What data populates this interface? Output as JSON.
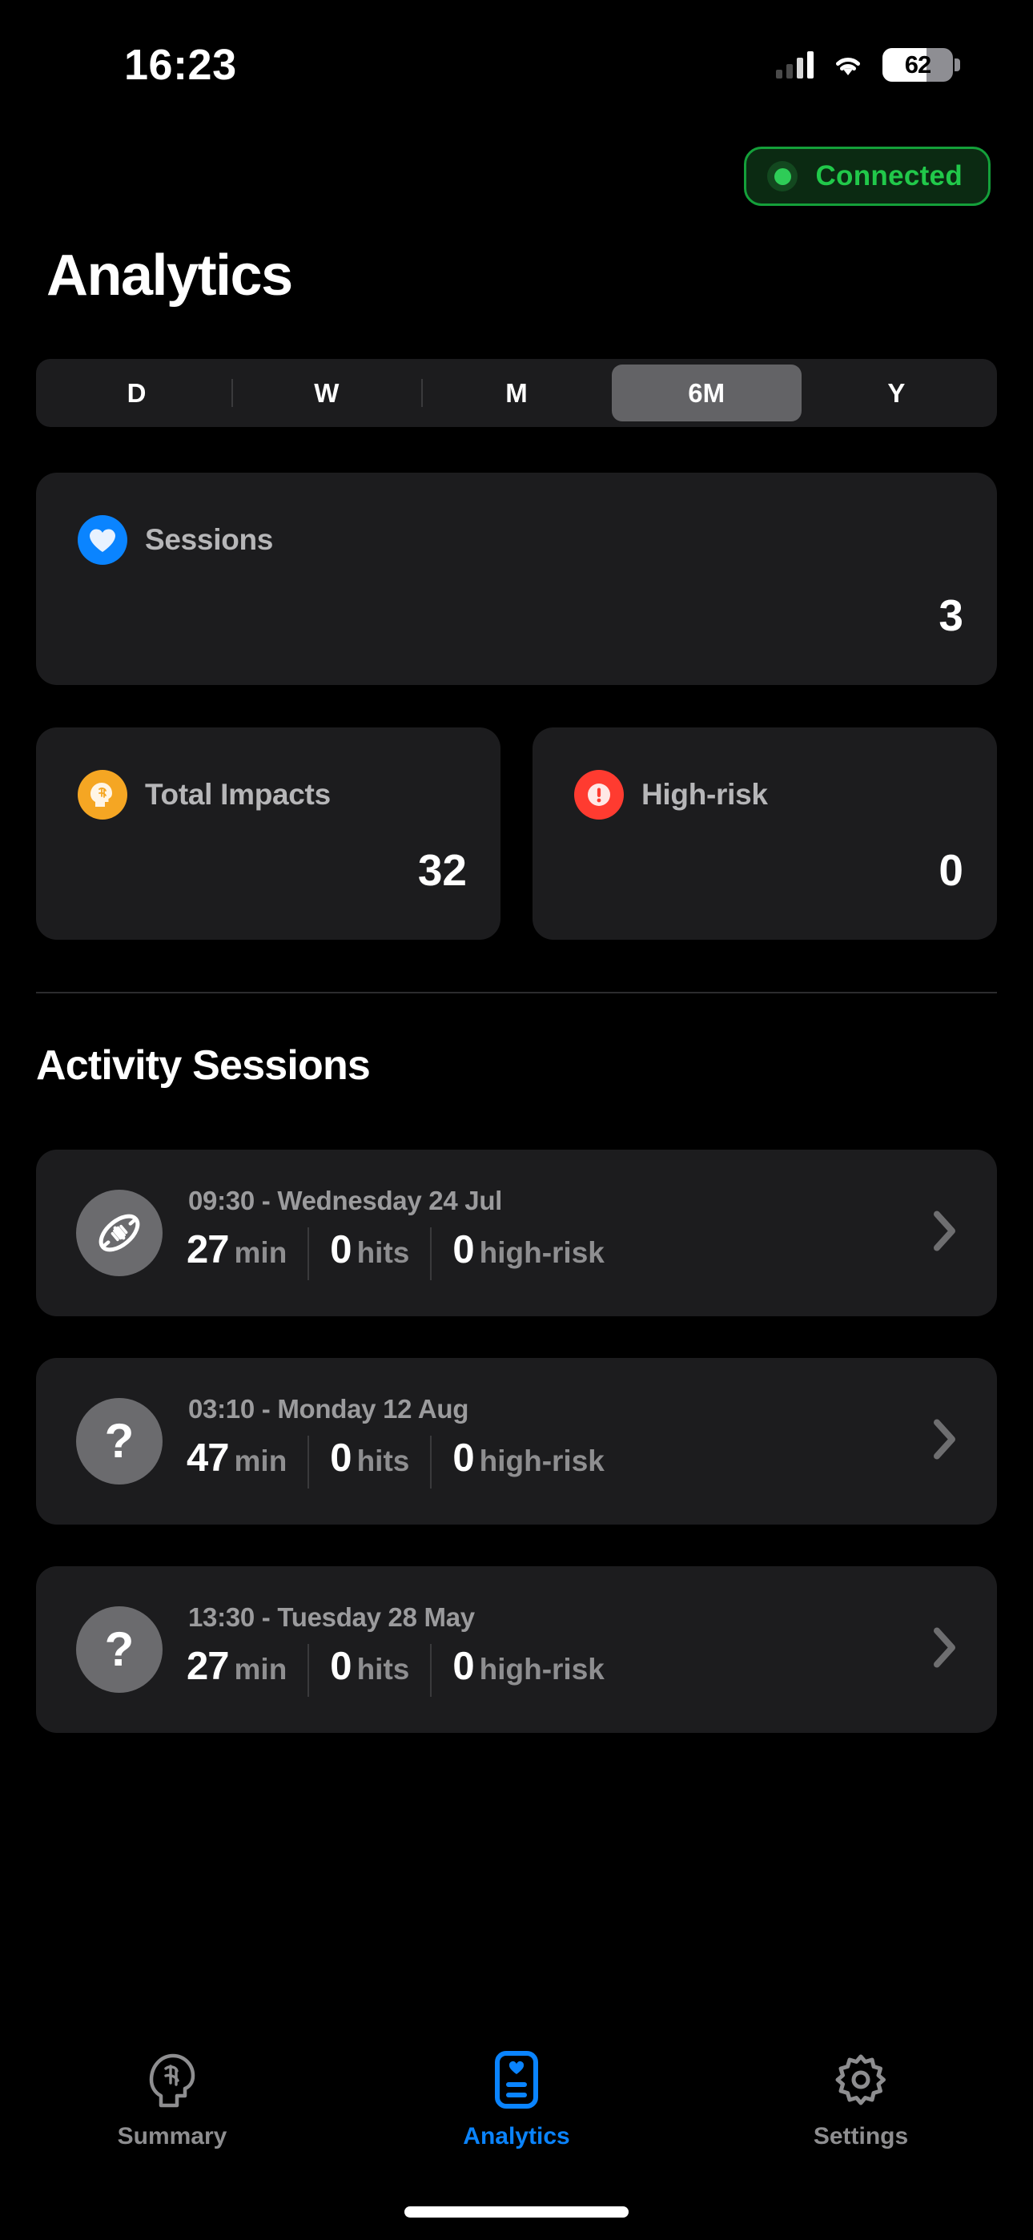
{
  "status_bar": {
    "time": "16:23",
    "battery_percent": "62",
    "icons": [
      "cellular-signal-icon",
      "wifi-icon",
      "battery-icon"
    ]
  },
  "connection": {
    "status_label": "Connected",
    "dot_color": "#2ecc57",
    "border_color": "#14a03a",
    "text_color": "#21c84a"
  },
  "header": {
    "title": "Analytics"
  },
  "range_selector": {
    "options": [
      {
        "label": "D",
        "selected": false
      },
      {
        "label": "W",
        "selected": false
      },
      {
        "label": "M",
        "selected": false
      },
      {
        "label": "6M",
        "selected": true
      },
      {
        "label": "Y",
        "selected": false
      }
    ],
    "selected": "6M"
  },
  "summary_cards": {
    "sessions": {
      "label": "Sessions",
      "value": "3",
      "icon": "heart-icon",
      "icon_bg": "#0a84ff"
    },
    "total_impacts": {
      "label": "Total Impacts",
      "value": "32",
      "icon": "brain-head-icon",
      "icon_bg": "#f5a623"
    },
    "high_risk": {
      "label": "High-risk",
      "value": "0",
      "icon": "exclamation-icon",
      "icon_bg": "#ff3b30"
    }
  },
  "activity": {
    "section_title": "Activity Sessions",
    "stat_units": {
      "duration": "min",
      "hits": "hits",
      "high_risk": "high-risk"
    },
    "sessions": [
      {
        "icon": "football-icon",
        "icon_glyph": "",
        "datetime": "09:30 - Wednesday 24 Jul",
        "duration": "27",
        "duration_unit": "min",
        "hits": "0",
        "hits_unit": "hits",
        "high_risk": "0",
        "high_risk_unit": "high-risk"
      },
      {
        "icon": "question-mark-icon",
        "icon_glyph": "?",
        "datetime": "03:10 - Monday 12 Aug",
        "duration": "47",
        "duration_unit": "min",
        "hits": "0",
        "hits_unit": "hits",
        "high_risk": "0",
        "high_risk_unit": "high-risk"
      },
      {
        "icon": "question-mark-icon",
        "icon_glyph": "?",
        "datetime": "13:30 - Tuesday 28 May",
        "duration": "27",
        "duration_unit": "min",
        "hits": "0",
        "hits_unit": "hits",
        "high_risk": "0",
        "high_risk_unit": "high-risk"
      }
    ]
  },
  "tab_bar": {
    "active_color": "#0a84ff",
    "inactive_color": "#8e8e90",
    "tabs": [
      {
        "label": "Summary",
        "icon": "brain-head-icon",
        "active": false
      },
      {
        "label": "Analytics",
        "icon": "analytics-card-icon",
        "active": true
      },
      {
        "label": "Settings",
        "icon": "gear-icon",
        "active": false
      }
    ]
  }
}
